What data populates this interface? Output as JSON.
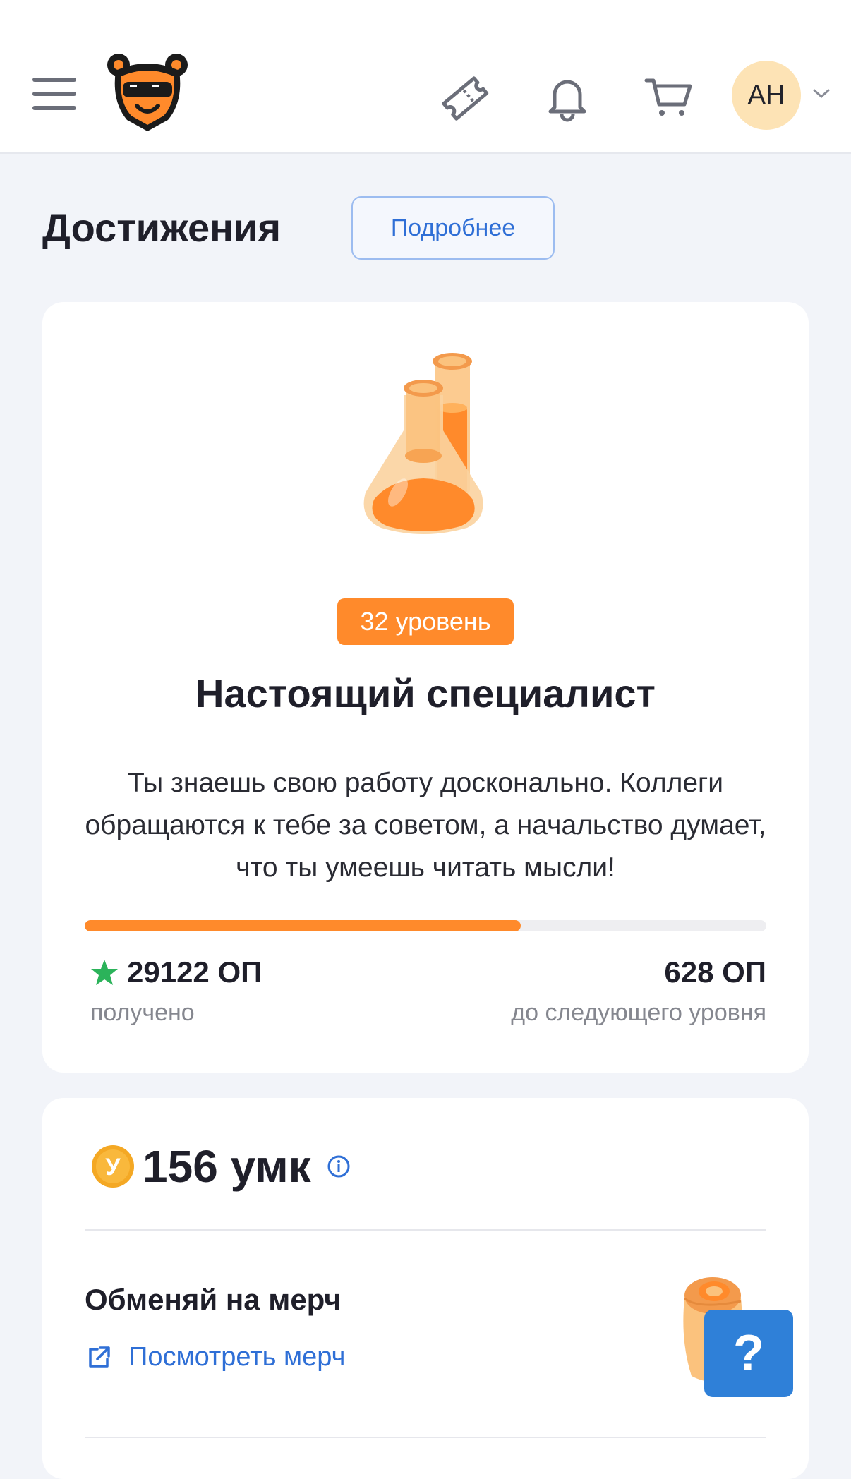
{
  "header": {
    "avatar_initials": "АН"
  },
  "achievements": {
    "title": "Достижения",
    "more_button": "Подробнее",
    "level_badge": "32 уровень",
    "level_title": "Настоящий специалист",
    "description": "Ты знаешь свою работу досконально. Коллеги обращаются к тебе за советом, а начальство думает, что ты умеешь читать мысли!",
    "progress_fraction": 0.64,
    "points_earned": "29122 ОП",
    "points_earned_caption": "получено",
    "points_to_next": "628 ОП",
    "points_to_next_caption": "до следующего уровня"
  },
  "coins": {
    "coin_letter": "У",
    "amount": "156 умк",
    "merch_title": "Обменяй на мерч",
    "merch_link": "Посмотреть мерч"
  },
  "help_button": "?",
  "colors": {
    "accent_orange": "#ff8a2b",
    "link_blue": "#2f6fd6",
    "help_blue": "#2f80d8",
    "star_green": "#2bb35a",
    "coin_gold": "#f4a824"
  },
  "icons": [
    "menu-icon",
    "bear-logo",
    "ticket-icon",
    "bell-icon",
    "cart-icon",
    "chevron-down-icon",
    "flask-icon",
    "star-icon",
    "coin-icon",
    "info-icon",
    "external-link-icon",
    "merch-icon"
  ]
}
